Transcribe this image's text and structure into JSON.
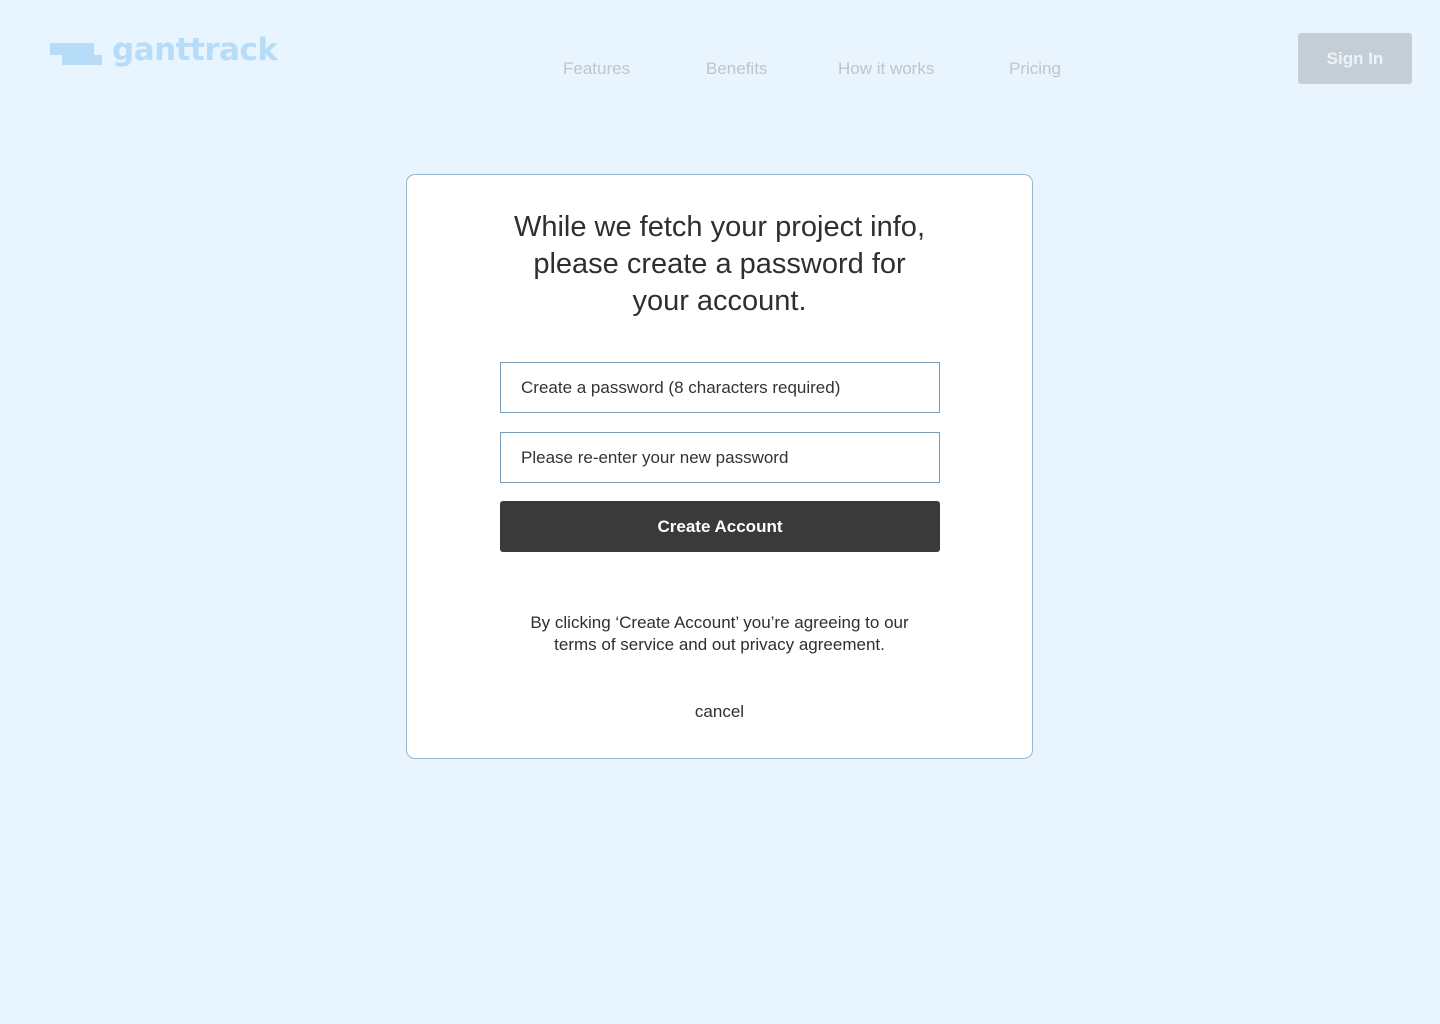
{
  "header": {
    "logo_text": "ganttrack",
    "nav": [
      {
        "label": "Features"
      },
      {
        "label": "Benefits"
      },
      {
        "label": "How it works"
      },
      {
        "label": "Pricing"
      }
    ],
    "sign_in_label": "Sign In"
  },
  "card": {
    "title_lines": [
      "While we fetch your project info,",
      "please create a password for",
      "your account."
    ],
    "password_placeholder": "Create a password (8 characters required)",
    "password_value": "",
    "confirm_placeholder": "Please re-enter your new password",
    "confirm_value": "",
    "create_button_label": "Create Account",
    "terms_text": "By clicking ‘Create Account’ you’re agreeing to our terms of service and out privacy agreement.",
    "cancel_label": "cancel"
  },
  "colors": {
    "page_background": "#e8f4fe",
    "logo": "#b6dcf7",
    "nav_text": "#bdc6cd",
    "sign_in_background": "#c3ced6",
    "card_border": "#98b6cc",
    "input_border": "#7a9bb5",
    "primary_button": "#3a3a3a",
    "text": "#2f2f2f"
  },
  "icons": {
    "logo_mark": "gantt-bars-icon"
  }
}
